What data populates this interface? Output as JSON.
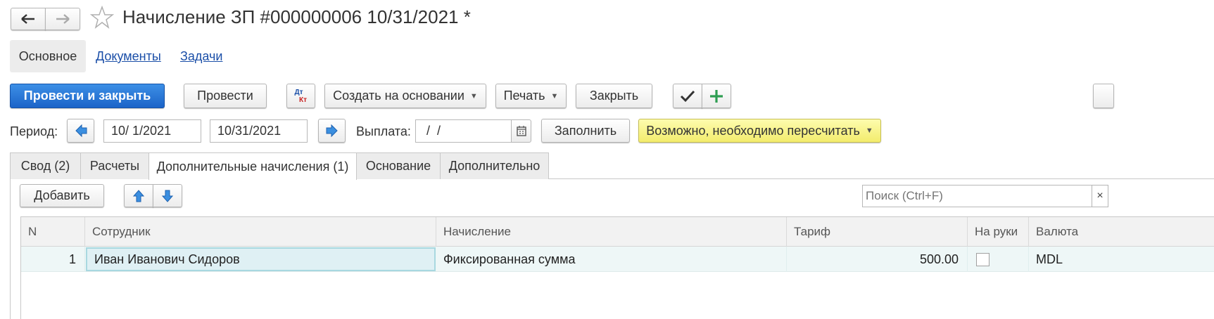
{
  "window": {
    "title": "Начисление ЗП #000000006 10/31/2021 *"
  },
  "nav": {
    "tabs": [
      "Основное",
      "Документы",
      "Задачи"
    ]
  },
  "toolbar": {
    "post_and_close": "Провести и закрыть",
    "post": "Провести",
    "dt_label": "Дт",
    "kt_label": "Кт",
    "create_based_on": "Создать на основании",
    "print": "Печать",
    "close": "Закрыть"
  },
  "period": {
    "label": "Период:",
    "from": "10/ 1/2021",
    "to": "10/31/2021",
    "payout_label": "Выплата:",
    "payout_value": " /  / ",
    "fill_button": "Заполнить",
    "recalc_notice": "Возможно, необходимо пересчитать"
  },
  "tabs": [
    "Свод (2)",
    "Расчеты",
    "Дополнительные начисления (1)",
    "Основание",
    "Дополнительно"
  ],
  "active_tab": "Дополнительные начисления (1)",
  "table_toolbar": {
    "add": "Добавить",
    "search_placeholder": "Поиск (Ctrl+F)"
  },
  "table": {
    "columns": [
      "N",
      "Сотрудник",
      "Начисление",
      "Тариф",
      "На руки",
      "Валюта"
    ],
    "rows": [
      {
        "n": "1",
        "employee": "Иван Иванович Сидоров",
        "accrual": "Фиксированная сумма",
        "rate": "500.00",
        "in_hand": false,
        "currency": "MDL"
      }
    ]
  },
  "colors": {
    "primary": "#1c64c8",
    "highlight_yellow": "#f3ec6d",
    "row_selected": "#eef7f7",
    "link": "#1b4fa8"
  }
}
